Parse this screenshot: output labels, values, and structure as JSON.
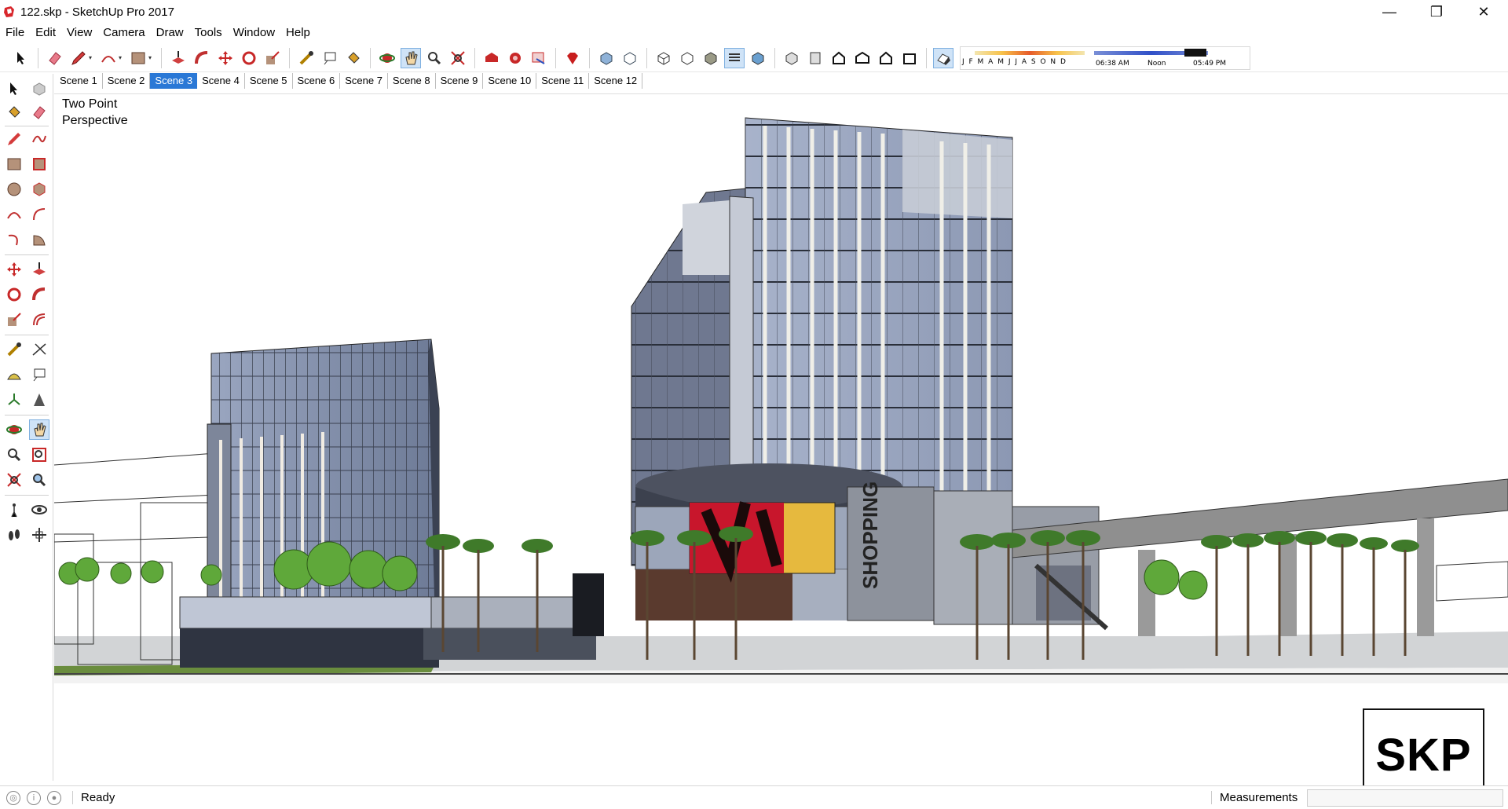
{
  "window": {
    "title": "122.skp - SketchUp Pro 2017",
    "controls": {
      "minimize": "—",
      "restore": "❐",
      "close": "✕"
    }
  },
  "menu": [
    "File",
    "Edit",
    "View",
    "Camera",
    "Draw",
    "Tools",
    "Window",
    "Help"
  ],
  "shadow": {
    "months": "J F M A M J J A S O N D",
    "time_start": "06:38 AM",
    "time_mid": "Noon",
    "time_end": "05:49 PM"
  },
  "scenes": {
    "tabs": [
      "Scene 1",
      "Scene 2",
      "Scene 3",
      "Scene 4",
      "Scene 5",
      "Scene 6",
      "Scene 7",
      "Scene 8",
      "Scene 9",
      "Scene 10",
      "Scene 11",
      "Scene 12"
    ],
    "active": "Scene 3"
  },
  "viewport": {
    "camera_line1": "Two Point",
    "camera_line2": "Perspective",
    "sign_text": "SHOPPING",
    "watermark": "SKP"
  },
  "status": {
    "text": "Ready",
    "measurements_label": "Measurements",
    "measurements_value": ""
  },
  "toolbar_icons": [
    "select-icon",
    "eraser-icon",
    "pencil-icon",
    "arc-icon",
    "rectangle-icon",
    "push-pull-icon",
    "follow-me-icon",
    "move-icon",
    "rotate-icon",
    "scale-icon",
    "tape-measure-icon",
    "text-icon",
    "paint-bucket-icon",
    "orbit-icon",
    "pan-icon",
    "zoom-icon",
    "zoom-extents-icon",
    "warehouse-icon",
    "extension-warehouse-icon",
    "layout-icon",
    "ruby-icon",
    "x-ray-icon",
    "back-edges-icon",
    "wireframe-icon",
    "hidden-line-icon",
    "shaded-icon",
    "shaded-textures-icon",
    "monochrome-icon",
    "iso-view-icon",
    "top-view-icon",
    "front-view-icon",
    "right-view-icon",
    "back-view-icon",
    "left-view-icon",
    "shadows-icon"
  ],
  "colors": {
    "accent": "#2a78d6",
    "glass": "#8796b3",
    "tree": "#5fa83a"
  }
}
